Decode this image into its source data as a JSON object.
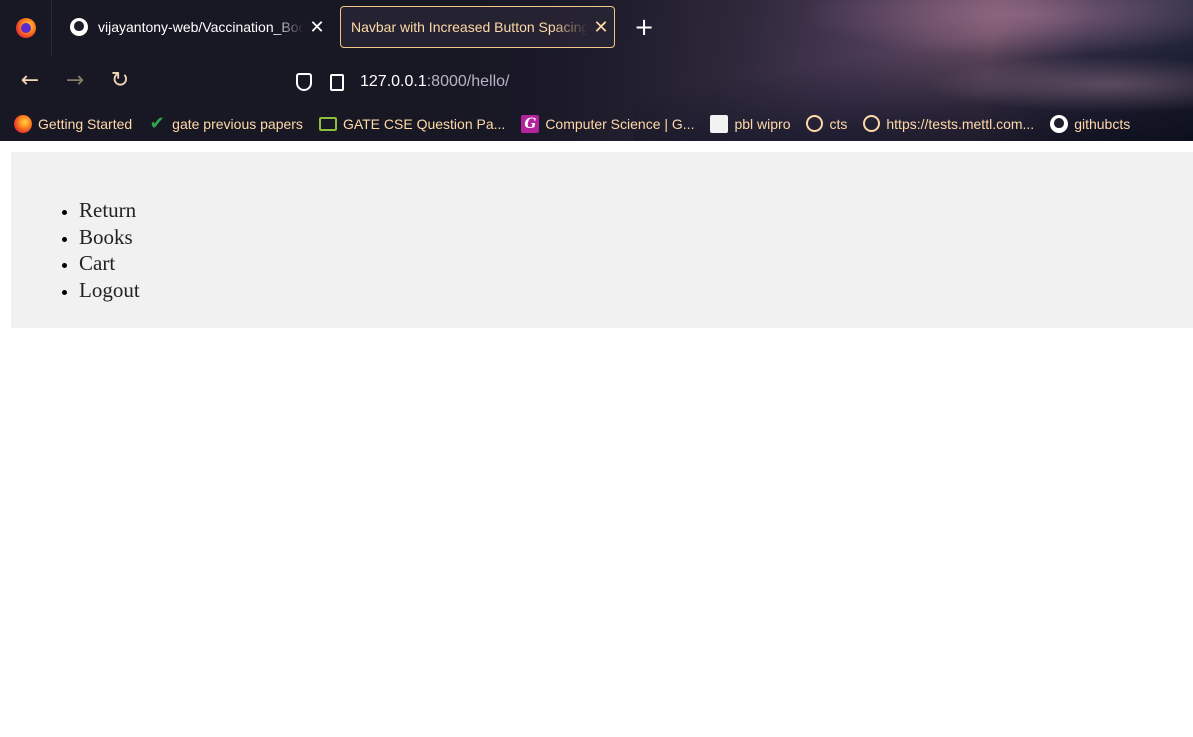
{
  "browser": {
    "tabs": [
      {
        "title": "vijayantony-web/Vaccination_Booking",
        "icon": "github-icon",
        "active": false
      },
      {
        "title": "Navbar with Increased Button Spacing",
        "icon": "",
        "active": true
      }
    ],
    "new_tab_symbol": "+",
    "close_symbol": "✕",
    "nav": {
      "back": "←",
      "forward": "→",
      "reload": "↻"
    },
    "url": {
      "host": "127.0.0.1",
      "rest": ":8000/hello/"
    },
    "bookmarks": [
      {
        "label": "Getting Started",
        "icon": "firefox-icon"
      },
      {
        "label": "gate previous papers",
        "icon": "checkmark-icon"
      },
      {
        "label": "GATE CSE Question Pa...",
        "icon": "books-icon"
      },
      {
        "label": "Computer Science | G...",
        "icon": "g-icon",
        "glyph": "G"
      },
      {
        "label": "pbl wipro",
        "icon": "document-icon"
      },
      {
        "label": "cts",
        "icon": "globe-icon"
      },
      {
        "label": "https://tests.mettl.com...",
        "icon": "globe-icon"
      },
      {
        "label": "githubcts",
        "icon": "github-icon"
      }
    ],
    "accent": "#ffd9a8"
  },
  "page": {
    "nav_items": [
      "Return",
      "Books",
      "Cart",
      "Logout"
    ],
    "panel_color": "#f1f1f1"
  }
}
